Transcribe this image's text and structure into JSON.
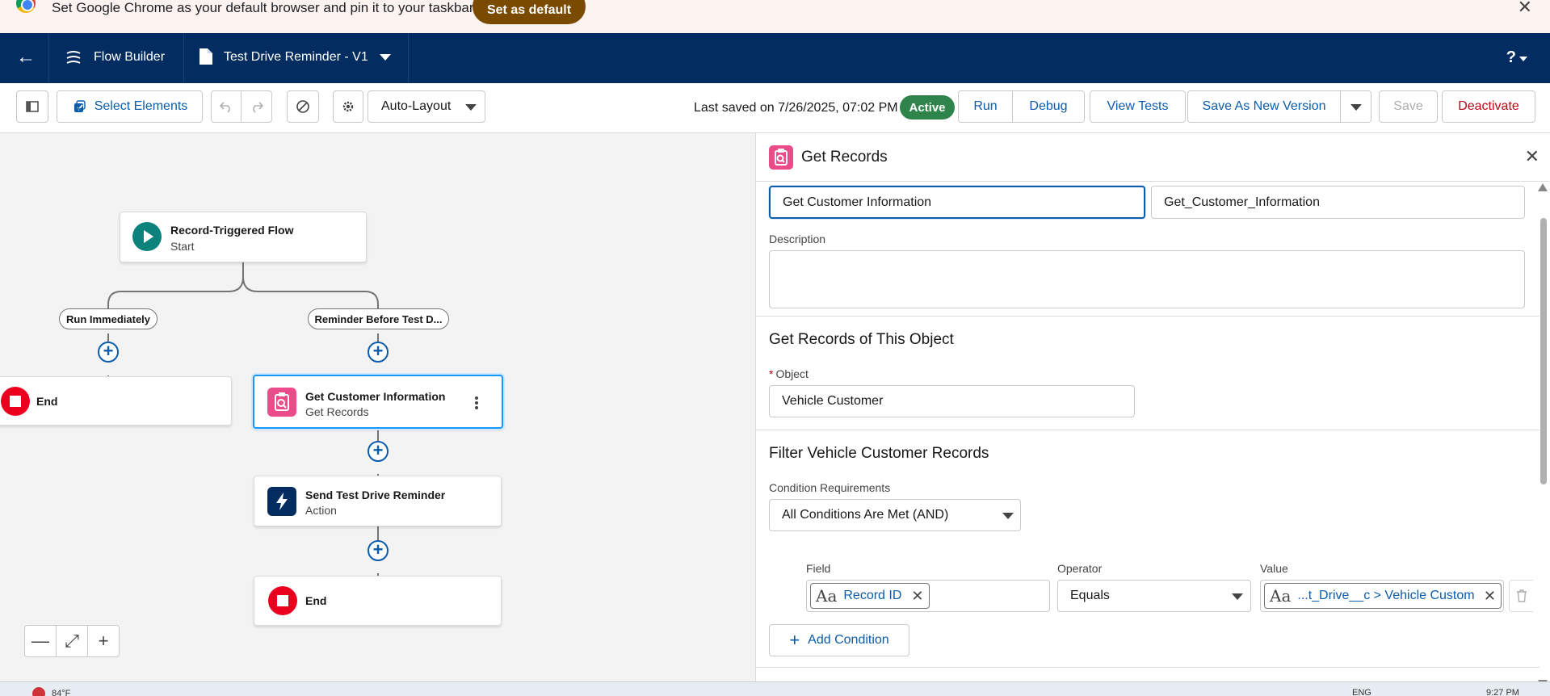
{
  "chrome_banner": {
    "message": "Set Google Chrome as your default browser and pin it to your taskbar",
    "button_label": "Set as default",
    "close_glyph": "✕"
  },
  "header": {
    "back_glyph": "←",
    "app_name": "Flow Builder",
    "flow_title": "Test Drive Reminder - V1",
    "help_glyph": "?"
  },
  "toolbar": {
    "select_elements_label": "Select Elements",
    "layout_mode": "Auto-Layout",
    "last_saved": "Last saved on 7/26/2025, 07:02 PM",
    "status_badge": "Active",
    "run_label": "Run",
    "debug_label": "Debug",
    "view_tests_label": "View Tests",
    "save_as_new_version_label": "Save As New Version",
    "save_label": "Save",
    "deactivate_label": "Deactivate"
  },
  "canvas": {
    "start_node": {
      "title": "Record-Triggered Flow",
      "subtitle": "Start"
    },
    "branches": [
      {
        "label": "Run Immediately"
      },
      {
        "label": "Reminder Before Test D..."
      }
    ],
    "end_left": {
      "title": "End"
    },
    "get_records_node": {
      "title": "Get Customer Information",
      "subtitle": "Get Records"
    },
    "action_node": {
      "title": "Send Test Drive Reminder",
      "subtitle": "Action"
    },
    "end_right": {
      "title": "End"
    },
    "plus_glyph": "+",
    "zoom": {
      "zoom_out": "—",
      "fit": "⤢",
      "zoom_in": "+"
    }
  },
  "panel": {
    "title": "Get Records",
    "close_glyph": "✕",
    "label_value": "Get Customer Information",
    "api_name_value": "Get_Customer_Information",
    "description_label": "Description",
    "description_value": "",
    "object_section_title": "Get Records of This Object",
    "object_label": "Object",
    "object_required_mark": "*",
    "object_value": "Vehicle Customer",
    "filter_section_title": "Filter Vehicle Customer Records",
    "condition_requirements_label": "Condition Requirements",
    "condition_requirements_value": "All Conditions Are Met (AND)",
    "condition": {
      "field_label": "Field",
      "field_value": "Record ID",
      "operator_label": "Operator",
      "operator_value": "Equals",
      "value_label": "Value",
      "value_value": "...t_Drive__c > Vehicle Customer"
    },
    "add_condition_label": "Add Condition",
    "text_type_glyph": "Aa"
  },
  "taskbar": {
    "weather": "84°F",
    "language": "ENG",
    "time": "9:27 PM"
  },
  "colors": {
    "header_bg": "#032d60",
    "brand_blue": "#0b5cab",
    "active_green": "#2e844a",
    "chrome_button": "#7a4a00",
    "get_records_pink": "#ea4c8a",
    "end_red": "#ea001e",
    "start_teal": "#0b827c",
    "action_navy": "#032d60"
  }
}
